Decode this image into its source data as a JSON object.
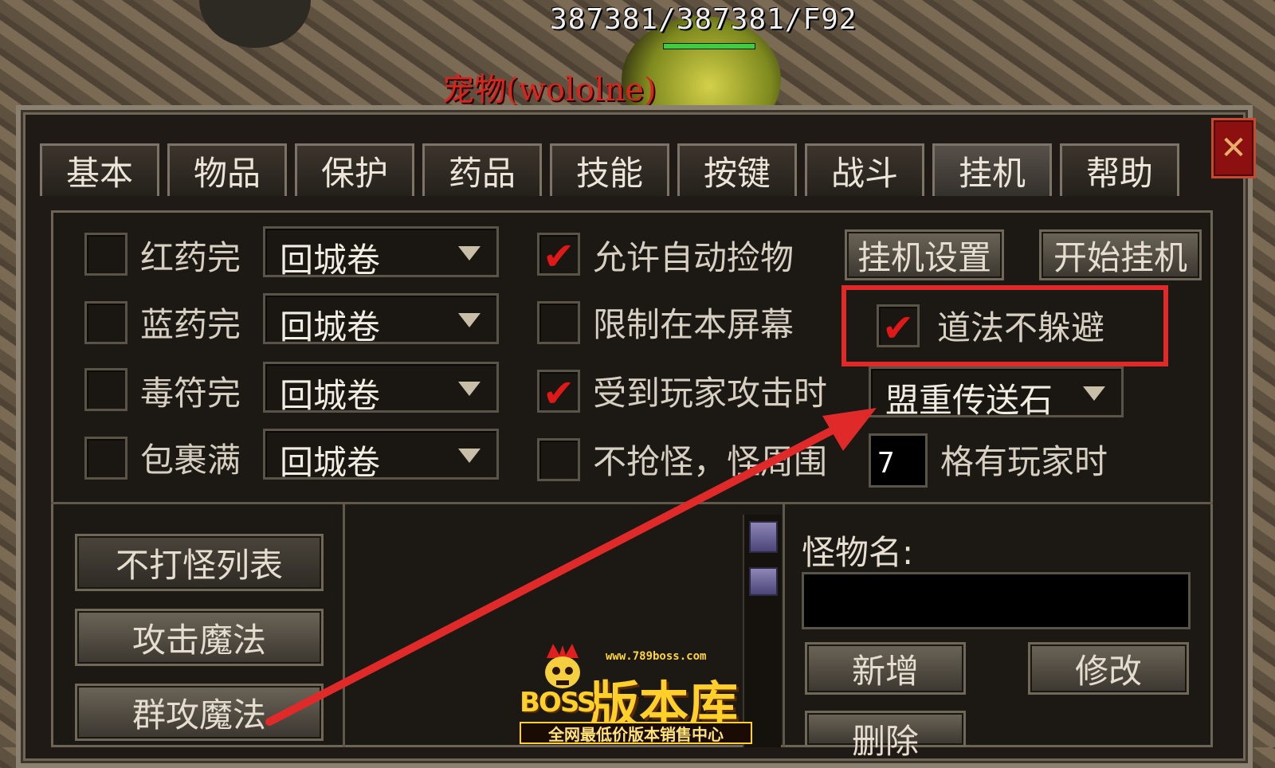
{
  "header": {
    "stats": "387381/387381/F92",
    "hp_fraction": 1.0,
    "pet_name": "宠物(wololne)"
  },
  "tabs": [
    "基本",
    "物品",
    "保护",
    "药品",
    "技能",
    "按键",
    "战斗",
    "挂机",
    "帮助"
  ],
  "active_tab": "挂机",
  "close_icon": "close-icon",
  "left_options": [
    {
      "label": "红药完",
      "checked": false,
      "select": "回城卷"
    },
    {
      "label": "蓝药完",
      "checked": false,
      "select": "回城卷"
    },
    {
      "label": "毒符完",
      "checked": false,
      "select": "回城卷"
    },
    {
      "label": "包裹满",
      "checked": false,
      "select": "回城卷"
    }
  ],
  "middle_options": [
    {
      "label": "允许自动捡物",
      "checked": true
    },
    {
      "label": "限制在本屏幕",
      "checked": false
    },
    {
      "label": "受到玩家攻击时",
      "checked": true
    },
    {
      "label": "不抢怪，怪周围",
      "checked": false
    }
  ],
  "buttons": {
    "hang_settings": "挂机设置",
    "start_hang": "开始挂机",
    "no_attack_list": "不打怪列表",
    "attack_magic": "攻击魔法",
    "group_magic": "群攻魔法",
    "add": "新增",
    "modify": "修改",
    "delete": "删除"
  },
  "no_dodge": {
    "label": "道法不躲避",
    "checked": true
  },
  "attacked_select": "盟重传送石",
  "range_value": "7",
  "range_suffix": "格有玩家时",
  "monster_name_label": "怪物名:",
  "monster_name_value": "",
  "annotation_color": "#e02a2a",
  "watermark": {
    "url": "www.789boss.com",
    "title": "版本库",
    "boss": "BOSS",
    "slogan": "全网最低价版本销售中心"
  }
}
